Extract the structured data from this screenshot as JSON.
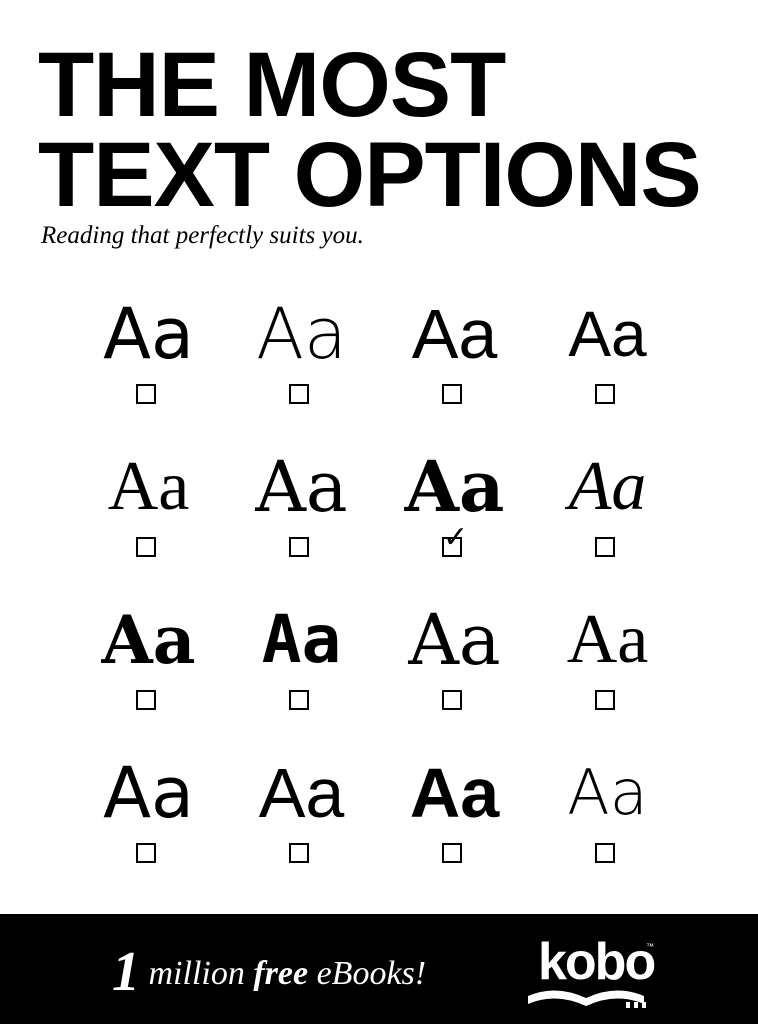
{
  "headline": {
    "line1": "THE MOST",
    "line2": "TEXT OPTIONS"
  },
  "subtitle": "Reading that perfectly suits you.",
  "font_samples": [
    {
      "text": "Aa",
      "checked": false
    },
    {
      "text": "Aa",
      "checked": false
    },
    {
      "text": "Aa",
      "checked": false
    },
    {
      "text": "Aa",
      "checked": false
    },
    {
      "text": "Aa",
      "checked": false
    },
    {
      "text": "Aa",
      "checked": false
    },
    {
      "text": "Aa",
      "checked": true
    },
    {
      "text": "Aa",
      "checked": false
    },
    {
      "text": "Aa",
      "checked": false
    },
    {
      "text": "Aa",
      "checked": false
    },
    {
      "text": "Aa",
      "checked": false
    },
    {
      "text": "Aa",
      "checked": false
    },
    {
      "text": "Aa",
      "checked": false
    },
    {
      "text": "Aa",
      "checked": false
    },
    {
      "text": "Aa",
      "checked": false
    },
    {
      "text": "Aa",
      "checked": false
    }
  ],
  "footer": {
    "tagline_number": "1",
    "tagline_mid": " million ",
    "tagline_free": "free",
    "tagline_end": " eBooks!",
    "logo_text": "kobo",
    "logo_tm": "™"
  },
  "colors": {
    "background": "#ffffff",
    "text": "#000000",
    "footer_bg": "#000000",
    "footer_text": "#ffffff"
  }
}
